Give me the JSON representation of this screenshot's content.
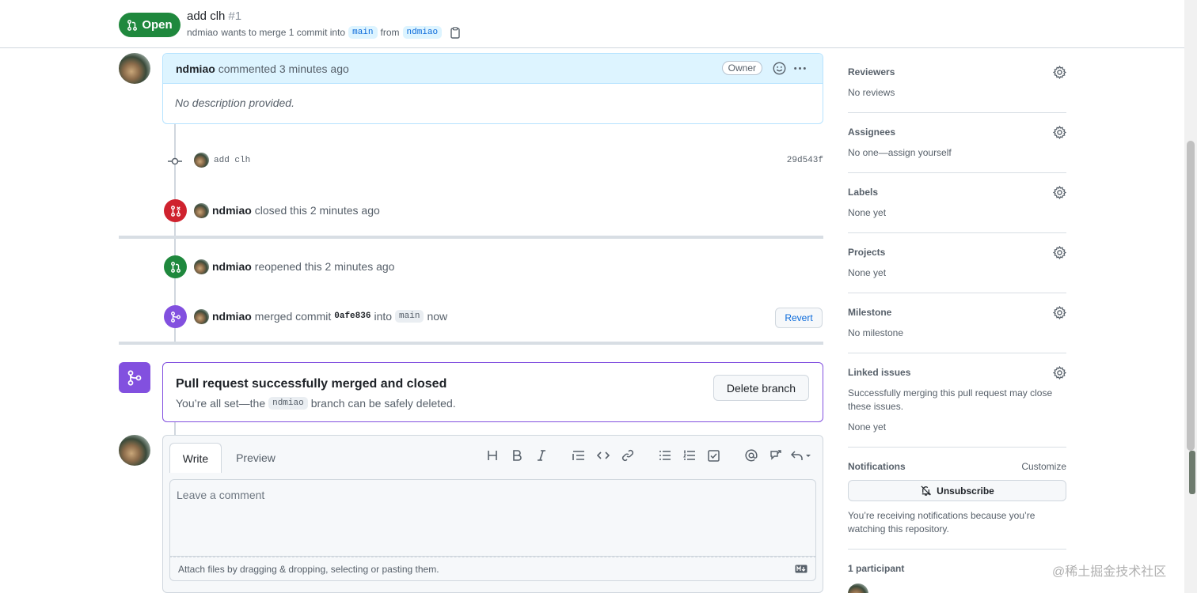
{
  "header": {
    "state": "Open",
    "title": "add clh",
    "number": "#1",
    "author": "ndmiao",
    "merge_text": "wants to merge 1 commit into",
    "base_branch": "main",
    "from_text": "from",
    "head_branch": "ndmiao"
  },
  "comment": {
    "author": "ndmiao",
    "action": "commented 3 minutes ago",
    "role": "Owner",
    "body": "No description provided."
  },
  "commit": {
    "message": "add clh",
    "sha": "29d543f"
  },
  "events": [
    {
      "author": "ndmiao",
      "text": "closed this 2 minutes ago"
    },
    {
      "author": "ndmiao",
      "text": "reopened this 2 minutes ago"
    },
    {
      "author": "ndmiao",
      "text": "merged commit",
      "sha": "0afe836",
      "into": "into",
      "branch": "main",
      "time": "now"
    }
  ],
  "revert_label": "Revert",
  "merged": {
    "title": "Pull request successfully merged and closed",
    "sub_before": "You’re all set—the",
    "branch": "ndmiao",
    "sub_after": "branch can be safely deleted.",
    "delete_label": "Delete branch"
  },
  "editor": {
    "tab_write": "Write",
    "tab_preview": "Preview",
    "placeholder": "Leave a comment",
    "attach": "Attach files by dragging & dropping, selecting or pasting them."
  },
  "sidebar": {
    "reviewers": {
      "title": "Reviewers",
      "value": "No reviews"
    },
    "assignees": {
      "title": "Assignees",
      "value": "No one—assign yourself"
    },
    "labels": {
      "title": "Labels",
      "value": "None yet"
    },
    "projects": {
      "title": "Projects",
      "value": "None yet"
    },
    "milestone": {
      "title": "Milestone",
      "value": "No milestone"
    },
    "linked": {
      "title": "Linked issues",
      "desc": "Successfully merging this pull request may close these issues.",
      "value": "None yet"
    },
    "notifications": {
      "title": "Notifications",
      "customize": "Customize",
      "button": "Unsubscribe",
      "reason": "You’re receiving notifications because you’re watching this repository."
    },
    "participants": {
      "title": "1 participant"
    }
  },
  "watermark": "@稀土掘金技术社区",
  "colors": {
    "open": "#1f883d",
    "closed": "#cf222e",
    "merged": "#8250df",
    "link": "#0969da"
  }
}
